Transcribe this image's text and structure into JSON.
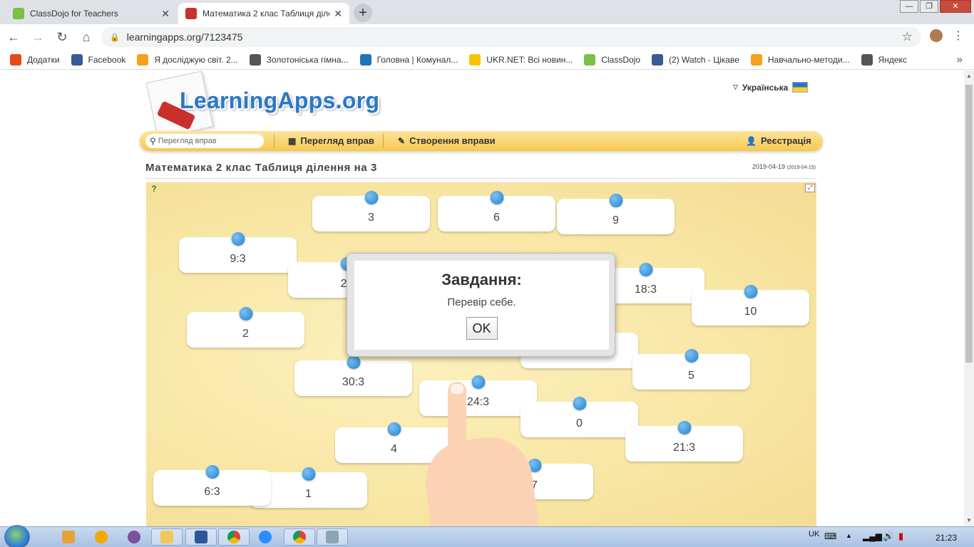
{
  "browser": {
    "tabs": [
      {
        "title": "ClassDojo for Teachers",
        "active": false,
        "favicon_color": "#7bc043"
      },
      {
        "title": "Математика 2 клас Таблиця діле",
        "active": true,
        "favicon_color": "#c9302c"
      }
    ],
    "new_tab_label": "+",
    "url": "learningapps.org/7123475",
    "bookmarks": [
      {
        "label": "Додатки",
        "icon": "apps-grid-icon",
        "color": "#e64a19"
      },
      {
        "label": "Facebook",
        "icon": "facebook-icon",
        "color": "#3b5998"
      },
      {
        "label": "Я досліджую світ. 2...",
        "icon": "bookmark-site-icon",
        "color": "#f4a21a"
      },
      {
        "label": "Золотоніська гімна...",
        "icon": "globe-icon",
        "color": "#555555"
      },
      {
        "label": "Головна | Комунал...",
        "icon": "edge-icon",
        "color": "#1e73be"
      },
      {
        "label": "UKR.NET: Всі новин...",
        "icon": "ukrnet-icon",
        "color": "#f7c600"
      },
      {
        "label": "ClassDojo",
        "icon": "classdojo-icon",
        "color": "#7bc043"
      },
      {
        "label": "(2) Watch - Цікаве",
        "icon": "facebook-icon",
        "color": "#3b5998"
      },
      {
        "label": "Навчально-методи...",
        "icon": "bookmark-site-icon",
        "color": "#f4a21a"
      },
      {
        "label": "Яндекс",
        "icon": "globe-icon",
        "color": "#555555"
      }
    ],
    "bookmarks_more": "»"
  },
  "site": {
    "logo_text": "LearningApps.org",
    "language": "Українська",
    "search_placeholder": "Перегляд вправ",
    "nav": {
      "browse": "Перегляд вправ",
      "create": "Створення вправи",
      "register": "Реєстрація"
    },
    "exercise_title": "Математика 2 клас Таблиця ділення на 3",
    "date": "2019-04-19",
    "date_small": "(2019-04-15)"
  },
  "cards": [
    {
      "label": "3"
    },
    {
      "label": "6"
    },
    {
      "label": "9"
    },
    {
      "label": "9:3"
    },
    {
      "label": "27"
    },
    {
      "label": "18:3"
    },
    {
      "label": "10"
    },
    {
      "label": "2"
    },
    {
      "label": ""
    },
    {
      "label": "5"
    },
    {
      "label": "30:3"
    },
    {
      "label": "24:3"
    },
    {
      "label": "0"
    },
    {
      "label": "4"
    },
    {
      "label": "21:3"
    },
    {
      "label": "7"
    },
    {
      "label": "1"
    },
    {
      "label": "6:3"
    }
  ],
  "dialog": {
    "heading": "Завдання:",
    "message": "Перевір себе.",
    "ok_label": "OK"
  },
  "taskbar": {
    "language": "UK",
    "time": "21:23"
  }
}
